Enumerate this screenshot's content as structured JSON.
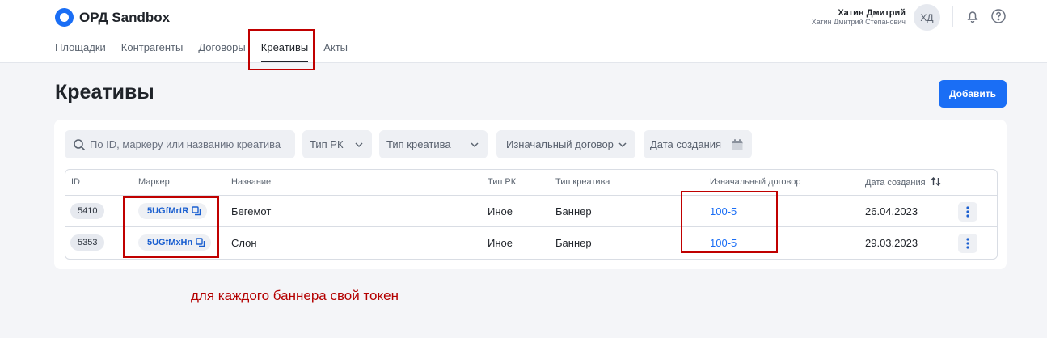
{
  "brand": {
    "name": "ОРД Sandbox"
  },
  "user": {
    "name": "Хатин Дмитрий",
    "full_name": "Хатин Дмитрий Степанович",
    "initials": "ХД"
  },
  "nav": {
    "items": [
      "Площадки",
      "Контрагенты",
      "Договоры",
      "Креативы",
      "Акты"
    ],
    "active": "Креативы"
  },
  "page": {
    "title": "Креативы",
    "add_label": "Добавить"
  },
  "filters": {
    "search_placeholder": "По ID, маркеру или названию креатива",
    "campaign_type": "Тип РК",
    "creative_type": "Тип креатива",
    "contract": "Изначальный договор",
    "created": "Дата создания"
  },
  "table": {
    "columns": [
      "ID",
      "Маркер",
      "Название",
      "Тип РК",
      "Тип креатива",
      "Изначальный договор",
      "Дата создания"
    ],
    "rows": [
      {
        "id": "5410",
        "marker": "5UGfMrtR",
        "name": "Бегемот",
        "campaign_type": "Иное",
        "creative_type": "Баннер",
        "contract": "100-5",
        "date": "26.04.2023"
      },
      {
        "id": "5353",
        "marker": "5UGfMxHn",
        "name": "Слон",
        "campaign_type": "Иное",
        "creative_type": "Баннер",
        "contract": "100-5",
        "date": "29.03.2023"
      }
    ]
  },
  "annotation": {
    "text": "для каждого баннера свой токен",
    "color": "#b40000"
  },
  "colors": {
    "accent": "#1a6ef5",
    "highlight": "#c00000"
  },
  "icons": [
    "search-icon",
    "chevron-down-icon",
    "calendar-icon",
    "sort-icon",
    "copy-icon",
    "more-vertical-icon",
    "bell-icon",
    "help-icon"
  ]
}
